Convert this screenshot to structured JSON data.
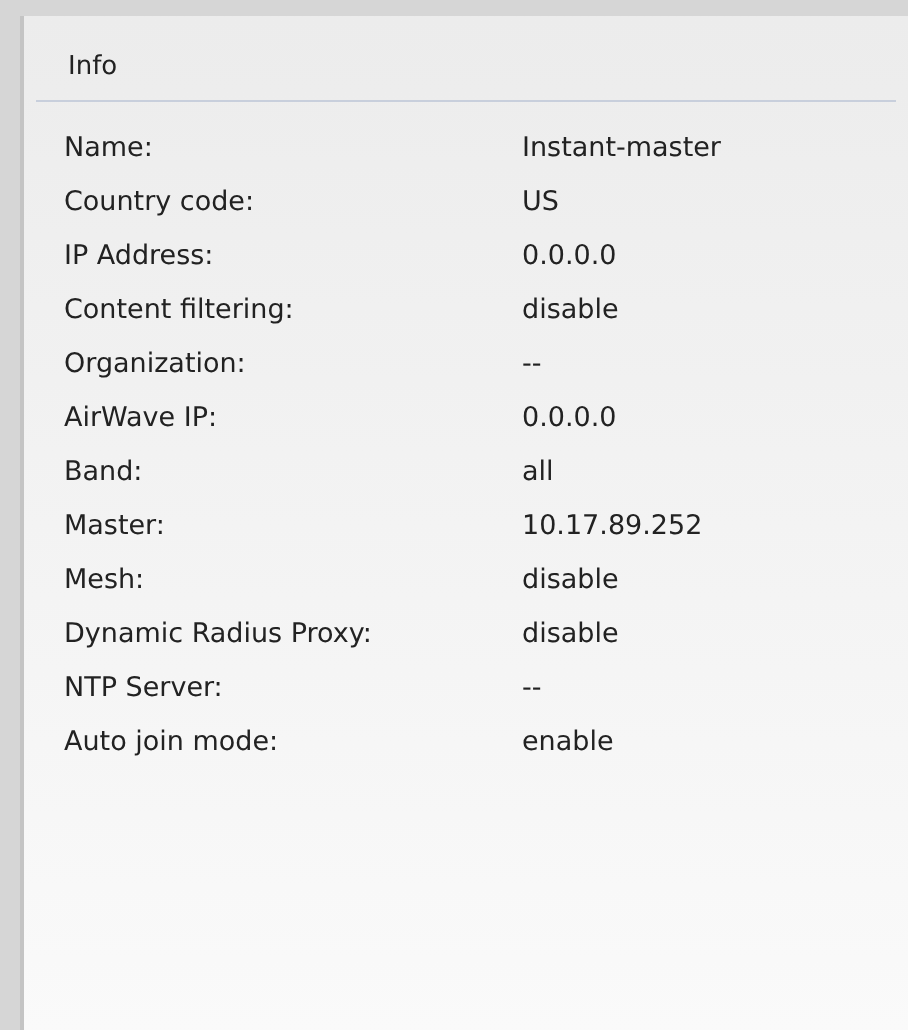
{
  "panel": {
    "title": "Info"
  },
  "rows": [
    {
      "label": "Name:",
      "value": "Instant-master"
    },
    {
      "label": "Country code:",
      "value": "US"
    },
    {
      "label": "IP Address:",
      "value": "0.0.0.0"
    },
    {
      "label": "Content filtering:",
      "value": "disable"
    },
    {
      "label": "Organization:",
      "value": "--"
    },
    {
      "label": "AirWave IP:",
      "value": "0.0.0.0"
    },
    {
      "label": "Band:",
      "value": "all"
    },
    {
      "label": "Master:",
      "value": "10.17.89.252"
    },
    {
      "label": "Mesh:",
      "value": "disable"
    },
    {
      "label": "Dynamic Radius Proxy:",
      "value": "disable"
    },
    {
      "label": "NTP Server:",
      "value": "--"
    },
    {
      "label": "Auto join mode:",
      "value": "enable"
    }
  ]
}
